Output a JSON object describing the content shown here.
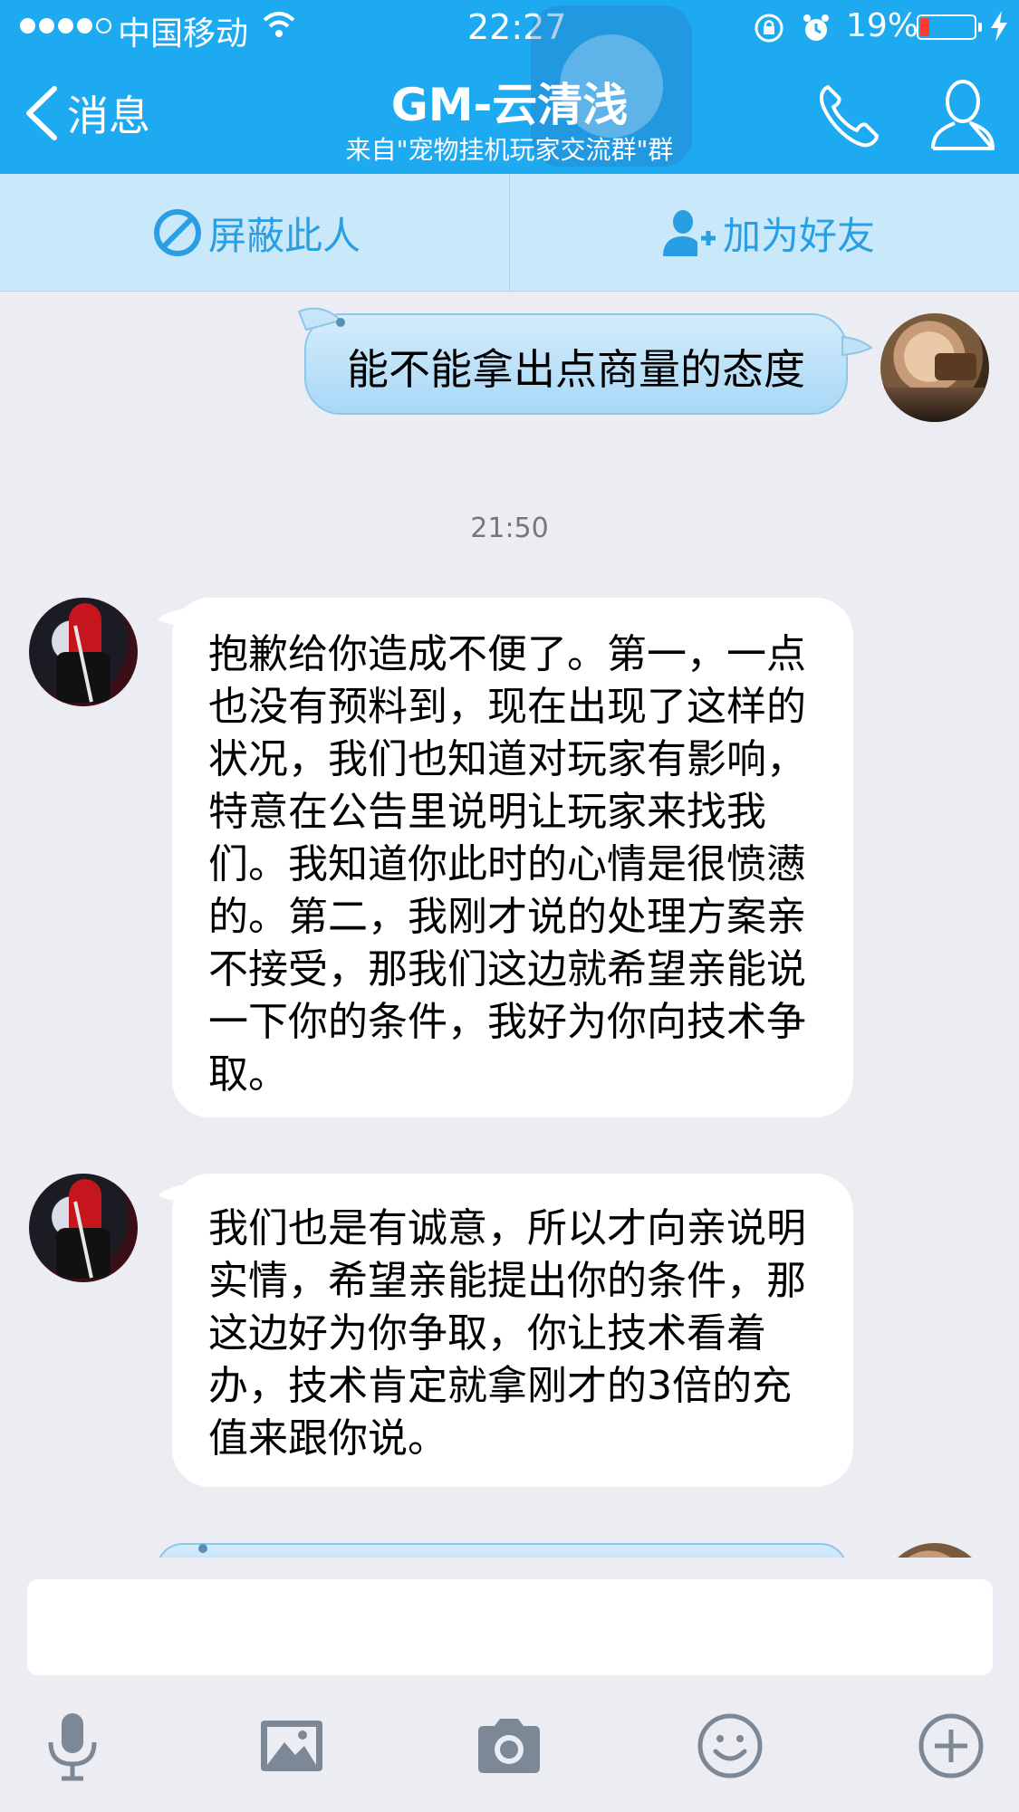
{
  "status_bar": {
    "carrier": "中国移动",
    "time": "22:27",
    "battery_percent": "19%",
    "battery_level": 0.19,
    "battery_color": "#ff3b30"
  },
  "header": {
    "back_label": "消息",
    "title": "GM-云清浅",
    "subtitle": "来自\"宠物挂机玩家交流群\"群",
    "background_color": "#1eaaf1",
    "icons": [
      "phone-icon",
      "profile-icon"
    ]
  },
  "action_bar": {
    "block_label": "屏蔽此人",
    "add_friend_label": "加为好友",
    "accent_color": "#2a9ee3"
  },
  "messages": {
    "sent_1": "能不能拿出点商量的态度",
    "timestamp": "21:50",
    "received_1": "抱歉给你造成不便了。第一，一点也没有预料到，现在出现了这样的状况，我们也知道对玩家有影响，特意在公告里说明让玩家来找我们。我知道你此时的心情是很愤懑的。第二，我刚才说的处理方案亲不接受，那我们这边就希望亲能说一下你的条件，我好为你向技术争取。",
    "received_2": "我们也是有诚意，所以才向亲说明实情，希望亲能提出你的条件，那这边好为你争取，你让技术看着办，技术肯定就拿刚才的3倍的充值来跟你说。"
  },
  "toolbar": {
    "icons": [
      "microphone-icon",
      "image-icon",
      "camera-icon",
      "emoji-icon",
      "plus-icon"
    ]
  }
}
